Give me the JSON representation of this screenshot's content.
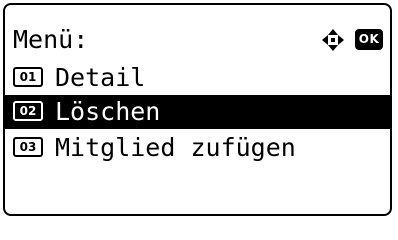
{
  "header": {
    "title": "Menü:",
    "nav_icon": "four-way-arrow-icon",
    "ok_label": "OK"
  },
  "menu": {
    "items": [
      {
        "number": "01",
        "label": "Detail",
        "selected": false
      },
      {
        "number": "02",
        "label": "Löschen",
        "selected": true
      },
      {
        "number": "03",
        "label": "Mitglied zufügen",
        "selected": false
      }
    ]
  },
  "colors": {
    "foreground": "#000000",
    "background": "#ffffff",
    "selection_background": "#000000",
    "selection_text": "#ffffff"
  }
}
